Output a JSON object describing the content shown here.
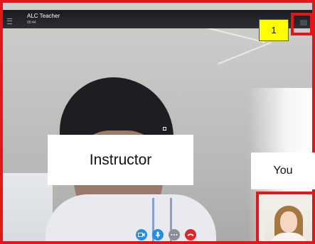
{
  "call": {
    "contact_name": "ALC Teacher",
    "duration": "00:44"
  },
  "annotations": {
    "marker_number": "1",
    "instructor_label": "Instructor",
    "self_label": "You"
  },
  "controls": [
    {
      "name": "video-camera-icon",
      "color": "#1e90e8"
    },
    {
      "name": "microphone-icon",
      "color": "#1e90e8"
    },
    {
      "name": "more-options-icon",
      "color": "#8a8f98"
    },
    {
      "name": "end-call-icon",
      "color": "#e0262c"
    }
  ],
  "colors": {
    "annotation_red": "#e3161b",
    "badge_yellow": "#ffff00",
    "title_bar": "#23242a"
  }
}
